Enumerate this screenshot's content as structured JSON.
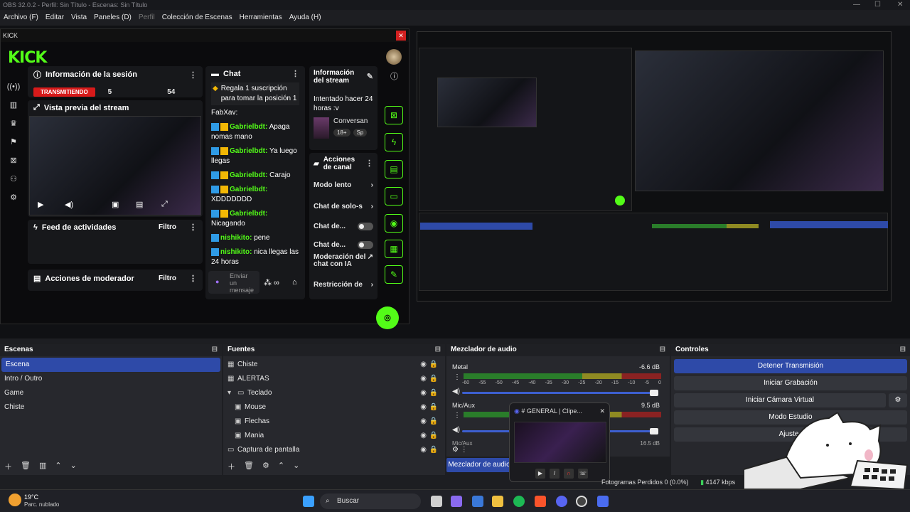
{
  "window": {
    "title": "OBS 32.0.2 - Perfil: Sin Título - Escenas: Sin Título"
  },
  "menu": [
    "Archivo (F)",
    "Editar",
    "Vista",
    "Paneles (D)",
    "Perfil",
    "Colección de Escenas",
    "Herramientas",
    "Ayuda (H)"
  ],
  "kick": {
    "window_title": "KICK",
    "logo": "KICK",
    "session": {
      "title": "Información de la sesión",
      "status": "TRANSMITIENDO",
      "val1": "5",
      "val2": "54"
    },
    "preview_title": "Vista previa del stream",
    "activity": {
      "title": "Feed de actividades",
      "filter": "Filtro"
    },
    "mod_actions": {
      "title": "Acciones de moderador",
      "filter": "Filtro"
    },
    "chat": {
      "title": "Chat",
      "pinned": "Regala 1 suscripción para tomar la posición 1",
      "first_user": "FabXav:",
      "messages": [
        {
          "user": "Gabrielbdt:",
          "text": "Apaga nomas mano"
        },
        {
          "user": "Gabrielbdt:",
          "text": "Ya luego llegas"
        },
        {
          "user": "Gabrielbdt:",
          "text": "Carajo"
        },
        {
          "user": "Gabrielbdt:",
          "text": "XDDDDDDD"
        },
        {
          "user": "Gabrielbdt:",
          "text": "Nicagando"
        },
        {
          "user": "nishikito:",
          "text": "pene"
        },
        {
          "user": "nishikito:",
          "text": "nica llegas las 24 horas"
        }
      ],
      "input_placeholder": "Enviar un mensaje"
    },
    "stream_info": {
      "title": "Información del stream",
      "status": "Intentado hacer 24 horas :v",
      "category": "Conversan",
      "tag1": "18+",
      "tag2": "Sp"
    },
    "channel_actions": {
      "title": "Acciones de canal",
      "items": [
        "Modo lento",
        "Chat de solo-s",
        "Chat de...",
        "Chat de...",
        "Moderación del chat con IA",
        "Restricción de"
      ]
    }
  },
  "docks": {
    "scenes": {
      "title": "Escenas",
      "items": [
        "Escena",
        "Intro / Outro",
        "Game",
        "Chiste"
      ]
    },
    "sources": {
      "title": "Fuentes",
      "items": [
        "Chiste",
        "ALERTAS",
        "Teclado",
        "Mouse",
        "Flechas",
        "Mania",
        "Captura de pantalla"
      ]
    },
    "mixer": {
      "title": "Mezclador de audio",
      "ch1": {
        "name": "Metal",
        "db": "-6.6 dB"
      },
      "ch2": {
        "name": "Mic/Aux",
        "db": "9.5 dB"
      },
      "ch3": {
        "name": "Mic/Aux",
        "db": "16.5 dB"
      },
      "scale": [
        "-60",
        "-55",
        "-50",
        "-45",
        "-40",
        "-35",
        "-30",
        "-25",
        "-20",
        "-15",
        "-10",
        "-5",
        "0"
      ],
      "tab_label": "Mezclador de audio"
    },
    "controls": {
      "title": "Controles",
      "stop_stream": "Detener Transmisión",
      "start_record": "Iniciar Grabación",
      "virtual_cam": "Iniciar Cámara Virtual",
      "studio_mode": "Modo Estudio",
      "settings": "Ajustes"
    }
  },
  "popup": {
    "title": "# GENERAL | Clipe..."
  },
  "status": {
    "dropped": "Fotogramas Perdidos 0 (0.0%)",
    "bitrate": "4147 kbps"
  },
  "taskbar": {
    "weather_temp": "19°C",
    "weather_desc": "Parc. nublado",
    "search": "Buscar"
  },
  "colors": {
    "kick_green": "#53fc18",
    "live_red": "#d71a1a",
    "obs_blue": "#2e4aa8"
  }
}
